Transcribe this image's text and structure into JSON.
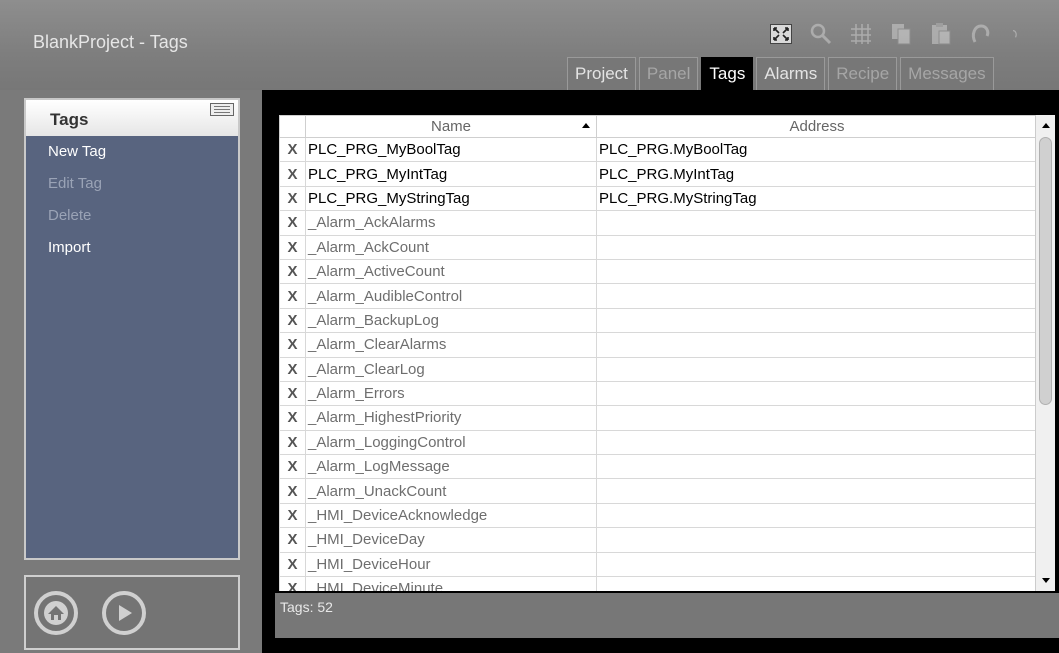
{
  "app": {
    "title": "BlankProject - Tags"
  },
  "toolbar": {
    "icons": [
      "fit-screen-icon",
      "magnifier-icon",
      "grid-icon",
      "copy-icon",
      "paste-icon",
      "undo-icon",
      "redo-icon"
    ]
  },
  "tabs": [
    {
      "label": "Project",
      "state": "enabled"
    },
    {
      "label": "Panel",
      "state": "disabled"
    },
    {
      "label": "Tags",
      "state": "selected"
    },
    {
      "label": "Alarms",
      "state": "enabled"
    },
    {
      "label": "Recipe",
      "state": "disabled"
    },
    {
      "label": "Messages",
      "state": "disabled"
    }
  ],
  "sidebar": {
    "title": "Tags",
    "items": [
      {
        "label": "New Tag",
        "enabled": true
      },
      {
        "label": "Edit Tag",
        "enabled": false
      },
      {
        "label": "Delete",
        "enabled": false
      },
      {
        "label": "Import",
        "enabled": true
      }
    ]
  },
  "table": {
    "columns": [
      "Name",
      "Address"
    ],
    "rows": [
      {
        "name": "PLC_PRG_MyBoolTag",
        "address": "PLC_PRG.MyBoolTag",
        "user": true
      },
      {
        "name": "PLC_PRG_MyIntTag",
        "address": "PLC_PRG.MyIntTag",
        "user": true
      },
      {
        "name": "PLC_PRG_MyStringTag",
        "address": "PLC_PRG.MyStringTag",
        "user": true
      },
      {
        "name": "_Alarm_AckAlarms",
        "address": "",
        "user": false
      },
      {
        "name": "_Alarm_AckCount",
        "address": "",
        "user": false
      },
      {
        "name": "_Alarm_ActiveCount",
        "address": "",
        "user": false
      },
      {
        "name": "_Alarm_AudibleControl",
        "address": "",
        "user": false
      },
      {
        "name": "_Alarm_BackupLog",
        "address": "",
        "user": false
      },
      {
        "name": "_Alarm_ClearAlarms",
        "address": "",
        "user": false
      },
      {
        "name": "_Alarm_ClearLog",
        "address": "",
        "user": false
      },
      {
        "name": "_Alarm_Errors",
        "address": "",
        "user": false
      },
      {
        "name": "_Alarm_HighestPriority",
        "address": "",
        "user": false
      },
      {
        "name": "_Alarm_LoggingControl",
        "address": "",
        "user": false
      },
      {
        "name": "_Alarm_LogMessage",
        "address": "",
        "user": false
      },
      {
        "name": "_Alarm_UnackCount",
        "address": "",
        "user": false
      },
      {
        "name": "_HMI_DeviceAcknowledge",
        "address": "",
        "user": false
      },
      {
        "name": "_HMI_DeviceDay",
        "address": "",
        "user": false
      },
      {
        "name": "_HMI_DeviceHour",
        "address": "",
        "user": false
      },
      {
        "name": "_HMI_DeviceMinute",
        "address": "",
        "user": false
      }
    ],
    "delete_glyph": "X"
  },
  "status": {
    "text": "Tags: 52"
  },
  "bottom": {
    "home_icon": "home-icon",
    "play_icon": "play-icon"
  }
}
